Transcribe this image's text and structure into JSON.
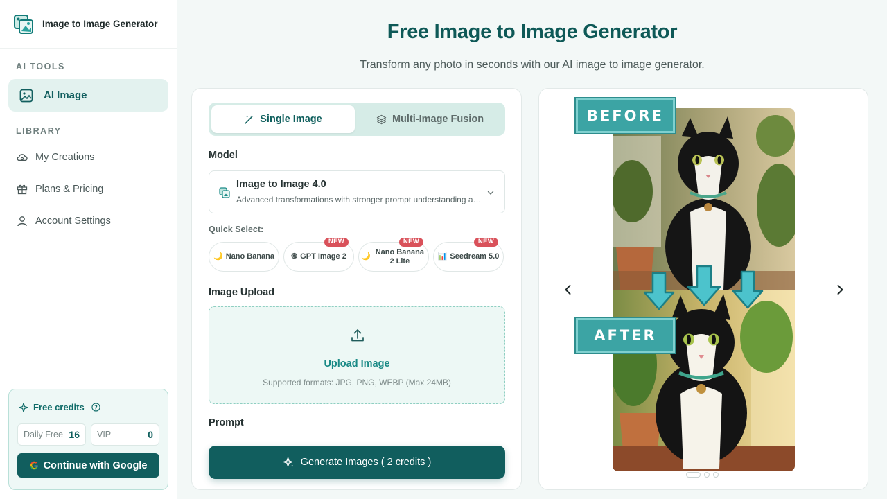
{
  "sidebar": {
    "brand": "Image to Image Generator",
    "ai_tools_label": "AI TOOLS",
    "ai_image_label": "AI Image",
    "library_label": "LIBRARY",
    "nav": [
      {
        "label": "My Creations",
        "icon": "cloud-icon"
      },
      {
        "label": "Plans & Pricing",
        "icon": "gift-icon"
      },
      {
        "label": "Account Settings",
        "icon": "user-icon"
      }
    ],
    "credits": {
      "title": "Free credits",
      "daily_label": "Daily Free",
      "daily_value": "16",
      "vip_label": "VIP",
      "vip_value": "0",
      "google_button": "Continue with Google"
    }
  },
  "header": {
    "title": "Free Image to Image Generator",
    "subtitle": "Transform any photo in seconds with our AI image to image generator."
  },
  "form": {
    "tabs": {
      "single": "Single Image",
      "multi": "Multi-Image Fusion"
    },
    "model_label": "Model",
    "model": {
      "name": "Image to Image 4.0",
      "description": "Advanced transformations with stronger prompt understanding and detail"
    },
    "quick_select_label": "Quick Select:",
    "quick_select": [
      {
        "icon": "🌙",
        "label": "Nano Banana",
        "badge": ""
      },
      {
        "icon": "֍",
        "label": "GPT Image 2",
        "badge": "NEW"
      },
      {
        "icon": "🌙",
        "label": "Nano Banana 2 Lite",
        "badge": "NEW"
      },
      {
        "icon": "📊",
        "label": "Seedream 5.0",
        "badge": "NEW"
      }
    ],
    "upload_label": "Image Upload",
    "upload_title": "Upload Image",
    "upload_hint": "Supported formats: JPG, PNG, WEBP (Max 24MB)",
    "prompt_label": "Prompt",
    "generate_button": "Generate Images ( 2 credits )"
  },
  "preview": {
    "before_label": "BEFORE",
    "after_label": "AFTER",
    "slides": 3,
    "active_slide": 1
  },
  "colors": {
    "accent": "#115e5e",
    "accent_light": "#e3f2ef",
    "badge_red": "#d9515a"
  }
}
